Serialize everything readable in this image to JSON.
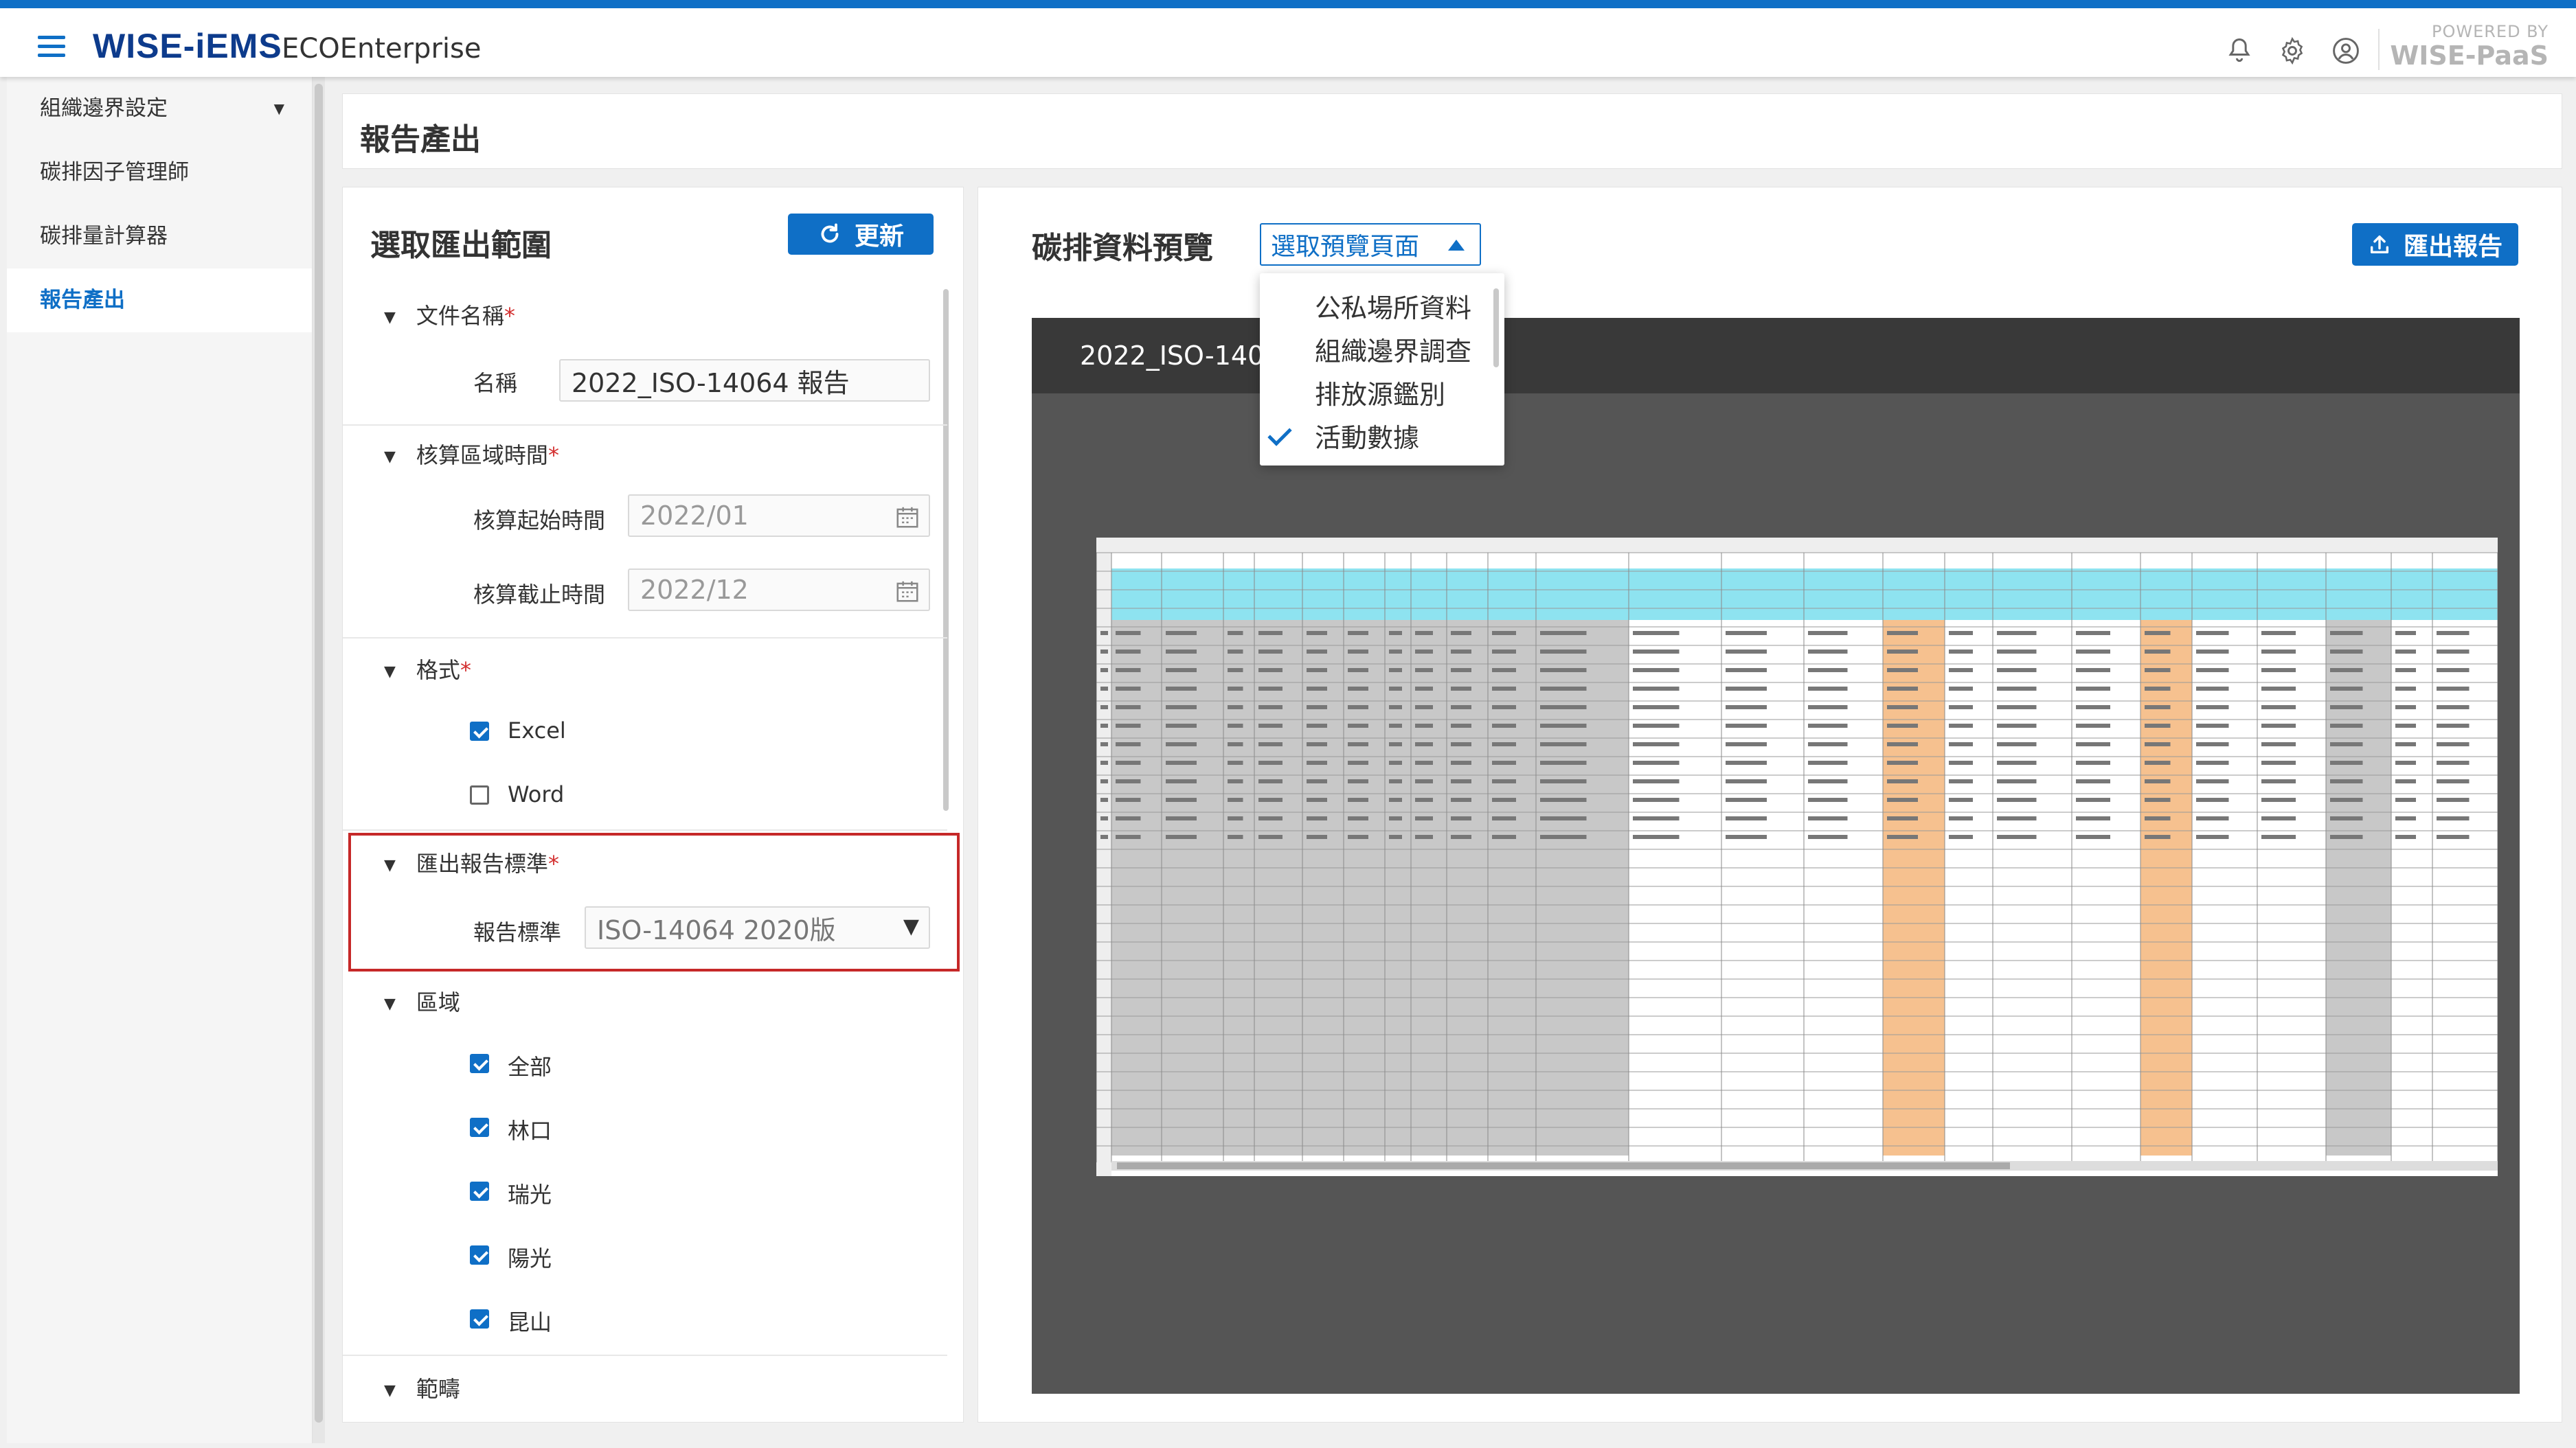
{
  "header": {
    "logo": "WISE-iEMS",
    "product": "ECOEnterprise",
    "powered_by": "POWERED BY",
    "powered_brand": "WISE-PaaS",
    "icons": [
      "bell-icon",
      "gear-icon",
      "user-circle-icon"
    ]
  },
  "sidebar": {
    "items": [
      {
        "label": "組織邊界設定",
        "active": false,
        "expandable": true
      },
      {
        "label": "碳排因子管理師",
        "active": false
      },
      {
        "label": "碳排量計算器",
        "active": false
      },
      {
        "label": "報告產出",
        "active": true
      }
    ]
  },
  "page": {
    "title": "報告產出"
  },
  "left_panel": {
    "title": "選取匯出範圍",
    "refresh_label": "更新",
    "doc_name": {
      "header": "文件名稱",
      "label": "名稱",
      "value": "2022_ISO-14064 報告"
    },
    "period": {
      "header": "核算區域時間",
      "start_label": "核算起始時間",
      "start_value": "2022/01",
      "end_label": "核算截止時間",
      "end_value": "2022/12"
    },
    "format": {
      "header": "格式",
      "options": [
        {
          "label": "Excel",
          "checked": true
        },
        {
          "label": "Word",
          "checked": false
        }
      ]
    },
    "standard": {
      "header": "匯出報告標準",
      "label": "報告標準",
      "value": "ISO-14064 2020版"
    },
    "region": {
      "header": "區域",
      "options": [
        {
          "label": "全部",
          "checked": true
        },
        {
          "label": "林口",
          "checked": true
        },
        {
          "label": "瑞光",
          "checked": true
        },
        {
          "label": "陽光",
          "checked": true
        },
        {
          "label": "昆山",
          "checked": true
        }
      ]
    },
    "scope": {
      "header": "範疇"
    }
  },
  "right_panel": {
    "title": "碳排資料預覽",
    "select_label": "選取預覽頁面",
    "export_label": "匯出報告",
    "dropdown": {
      "items": [
        "公私場所資料",
        "組織邊界調查",
        "排放源鑑別",
        "活動數據"
      ],
      "selected": "活動數據"
    },
    "preview_title": "2022_ISO-1406"
  },
  "colors": {
    "brand_blue": "#0f6fc6",
    "logo_navy": "#0d3b8c",
    "highlight_red": "#c62828",
    "sheet_header_cyan": "#8ee3f0",
    "sheet_gray": "#c8c8c8",
    "sheet_orange": "#f6c18f"
  }
}
